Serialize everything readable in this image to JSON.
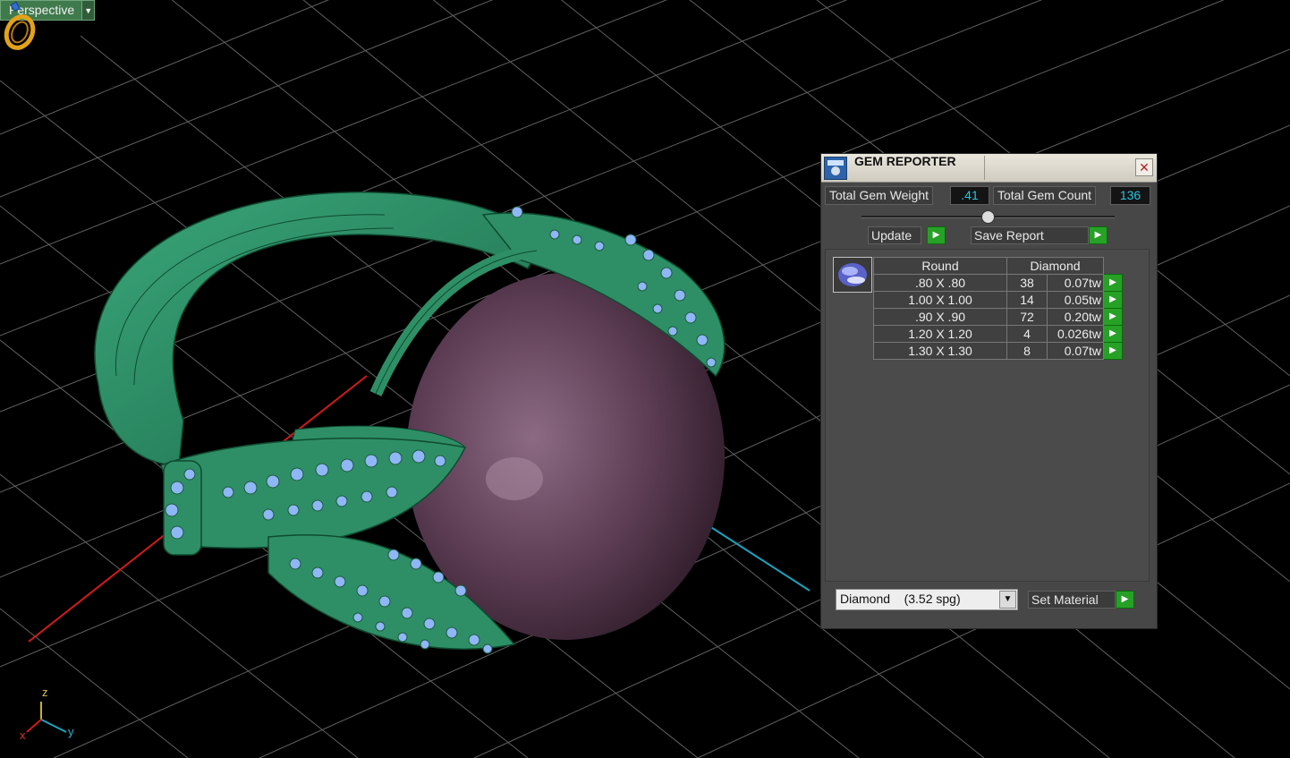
{
  "viewport": {
    "view_name": "Perspective",
    "axis_labels": {
      "x": "x",
      "y": "y",
      "z": "z"
    }
  },
  "gem_reporter": {
    "title": "GEM REPORTER",
    "total_weight_label": "Total Gem Weight",
    "total_weight_value": ".41",
    "total_count_label": "Total Gem Count",
    "total_count_value": "136",
    "update_label": "Update",
    "save_report_label": "Save Report",
    "table_headers": {
      "shape": "Round",
      "material": "Diamond"
    },
    "rows": [
      {
        "size": ".80 X .80",
        "count": "38",
        "weight": "0.07tw"
      },
      {
        "size": "1.00 X 1.00",
        "count": "14",
        "weight": "0.05tw"
      },
      {
        "size": ".90 X .90",
        "count": "72",
        "weight": "0.20tw"
      },
      {
        "size": "1.20 X 1.20",
        "count": "4",
        "weight": "0.026tw"
      },
      {
        "size": "1.30 X 1.30",
        "count": "8",
        "weight": "0.07tw"
      }
    ],
    "material_select": "Diamond    (3.52 spg)",
    "set_material_label": "Set Material"
  },
  "colors": {
    "ring_green": "#2e8f66",
    "pearl": "#6a4860",
    "gem_blue": "#8fb6f5",
    "value_cyan": "#27c3e0",
    "button_green": "#26a126"
  },
  "icons": [
    "dropdown-arrow-icon",
    "ring-logo-icon",
    "close-icon",
    "play-arrow-icon",
    "gem-thumbnail-icon",
    "select-arrow-icon"
  ]
}
